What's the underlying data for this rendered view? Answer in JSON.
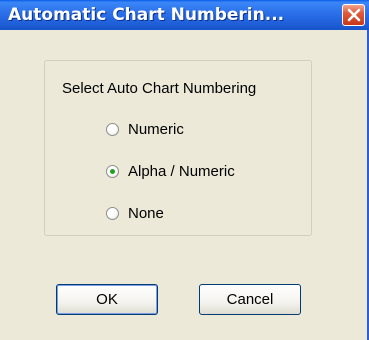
{
  "window": {
    "title": "Automatic Chart Numberin..."
  },
  "group": {
    "label": "Select Auto Chart Numbering"
  },
  "options": [
    {
      "label": "Numeric",
      "selected": false
    },
    {
      "label": "Alpha / Numeric",
      "selected": true
    },
    {
      "label": "None",
      "selected": false
    }
  ],
  "buttons": {
    "ok": "OK",
    "cancel": "Cancel"
  },
  "colors": {
    "titlebar": "#2a6fe9",
    "dialog_bg": "#ece9d8",
    "radio_selected": "#21a121",
    "close_button": "#e05a3a"
  }
}
